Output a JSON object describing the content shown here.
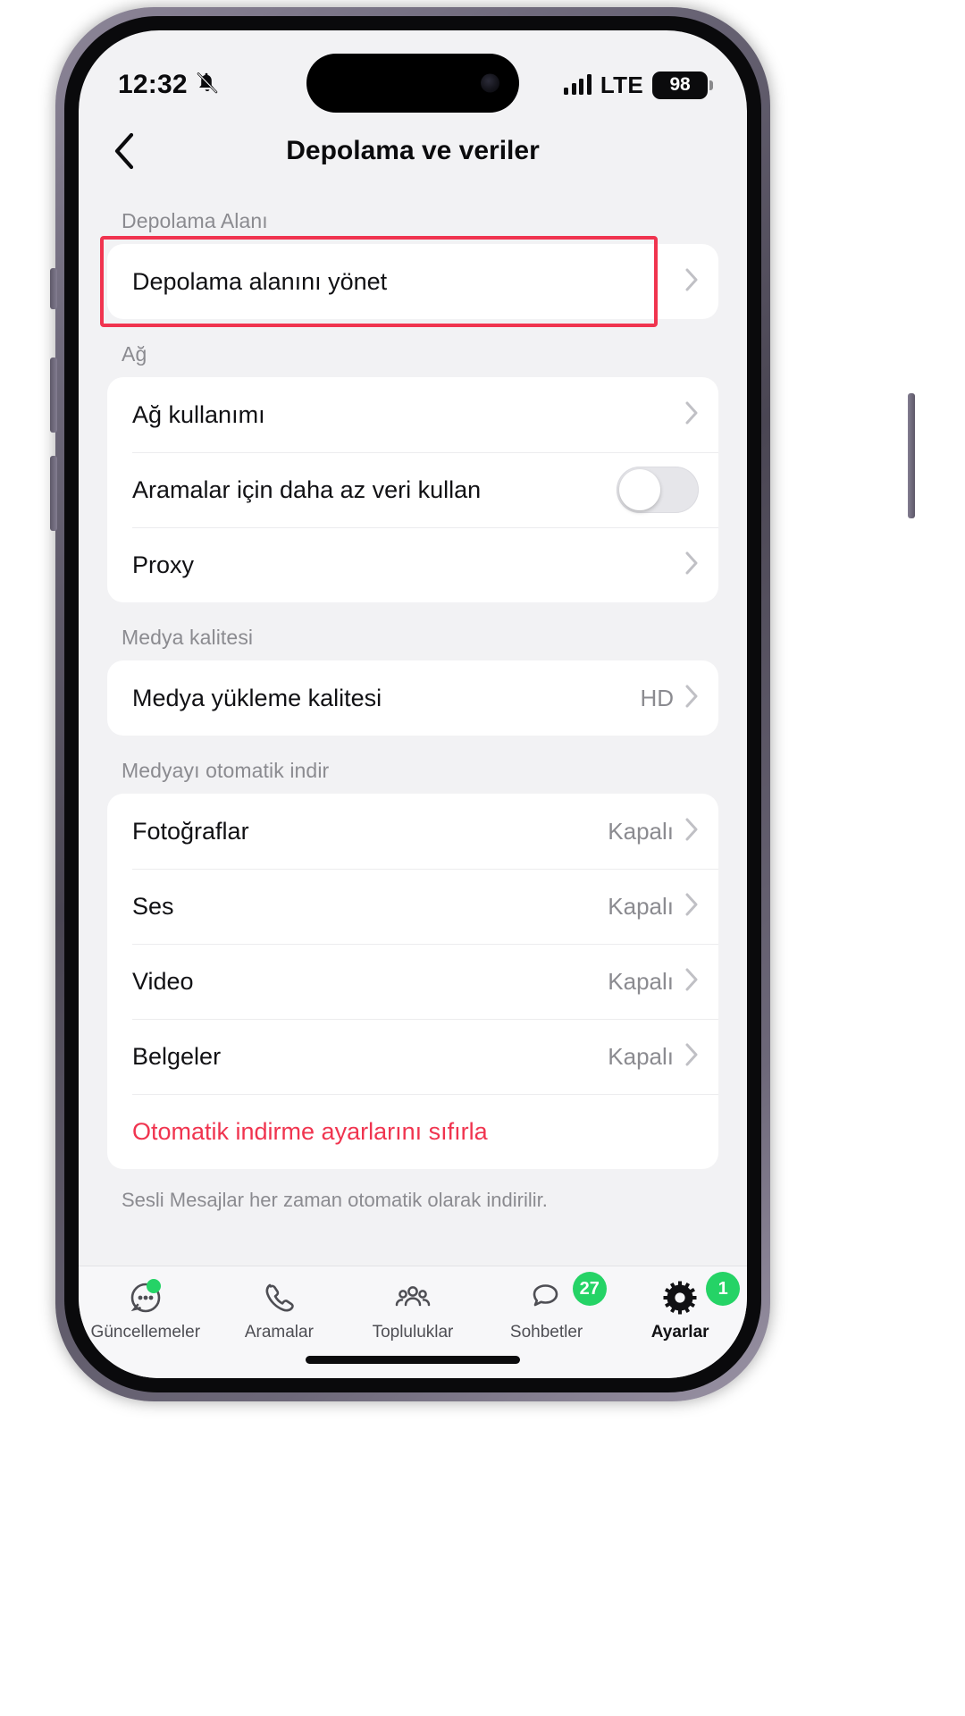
{
  "status_bar": {
    "time": "12:32",
    "mute_icon": "bell-slash-icon",
    "carrier": "LTE",
    "battery_level": "98",
    "signal_icon": "signal-bars-icon"
  },
  "nav": {
    "title": "Depolama ve veriler",
    "back_icon": "chevron-left-icon"
  },
  "sections": [
    {
      "header": "Depolama Alanı",
      "rows": [
        {
          "label": "Depolama alanını yönet",
          "value": "",
          "accessory": "chevron",
          "highlighted": true
        }
      ]
    },
    {
      "header": "Ağ",
      "rows": [
        {
          "label": "Ağ kullanımı",
          "value": "",
          "accessory": "chevron"
        },
        {
          "label": "Aramalar için daha az veri kullan",
          "value": "",
          "accessory": "toggle",
          "toggle_on": false
        },
        {
          "label": "Proxy",
          "value": "",
          "accessory": "chevron"
        }
      ]
    },
    {
      "header": "Medya kalitesi",
      "rows": [
        {
          "label": "Medya yükleme kalitesi",
          "value": "HD",
          "accessory": "chevron"
        }
      ]
    },
    {
      "header": "Medyayı otomatik indir",
      "rows": [
        {
          "label": "Fotoğraflar",
          "value": "Kapalı",
          "accessory": "chevron"
        },
        {
          "label": "Ses",
          "value": "Kapalı",
          "accessory": "chevron"
        },
        {
          "label": "Video",
          "value": "Kapalı",
          "accessory": "chevron"
        },
        {
          "label": "Belgeler",
          "value": "Kapalı",
          "accessory": "chevron"
        },
        {
          "label": "Otomatik indirme ayarlarını sıfırla",
          "value": "",
          "accessory": "none",
          "danger": true
        }
      ],
      "footnote": "Sesli Mesajlar her zaman otomatik olarak indirilir."
    }
  ],
  "tabs": [
    {
      "label": "Güncellemeler",
      "icon": "updates-icon",
      "badge": "",
      "dot": true,
      "active": false
    },
    {
      "label": "Aramalar",
      "icon": "phone-icon",
      "badge": "",
      "dot": false,
      "active": false
    },
    {
      "label": "Topluluklar",
      "icon": "communities-icon",
      "badge": "",
      "dot": false,
      "active": false
    },
    {
      "label": "Sohbetler",
      "icon": "chats-icon",
      "badge": "27",
      "dot": false,
      "active": false
    },
    {
      "label": "Ayarlar",
      "icon": "gear-icon",
      "badge": "1",
      "dot": false,
      "active": true
    }
  ],
  "colors": {
    "accent_red": "#f0344f",
    "badge_green": "#25d366",
    "page_bg": "#f2f2f4",
    "card_bg": "#ffffff"
  }
}
